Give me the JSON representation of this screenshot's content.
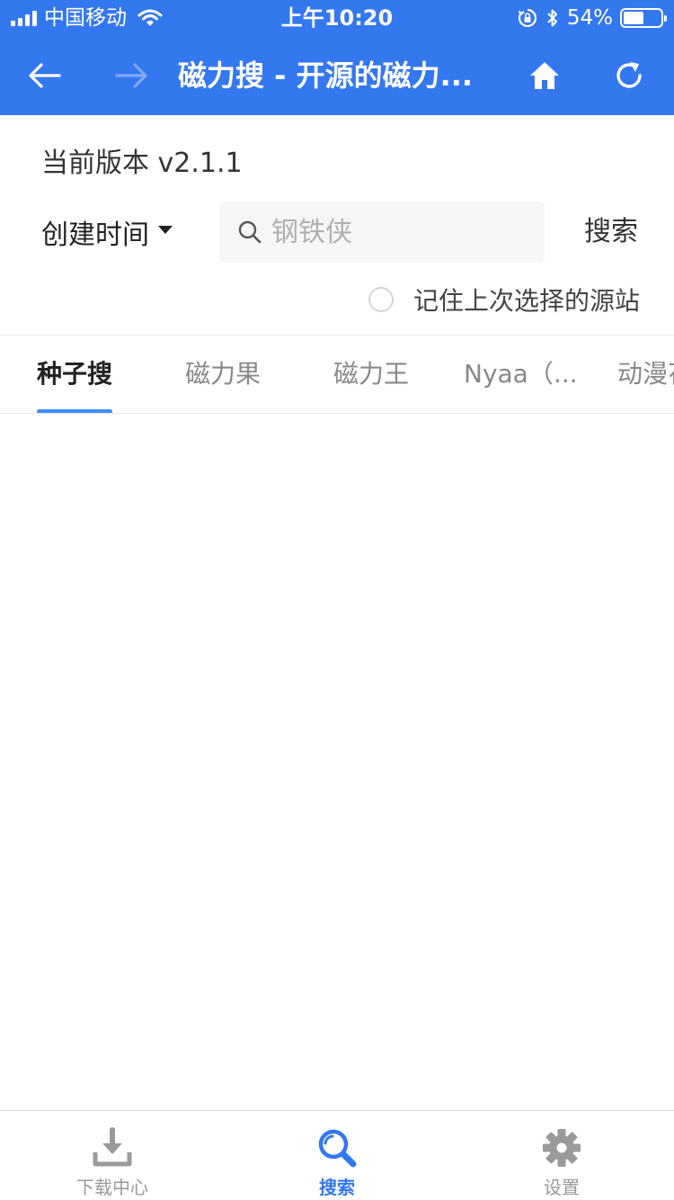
{
  "status_bar": {
    "carrier": "中国移动",
    "time": "上午10:20",
    "battery_percent_text": "54%",
    "battery_level": 0.54
  },
  "nav": {
    "title": "磁力搜 - 开源的磁力..."
  },
  "version_text": "当前版本 v2.1.1",
  "sort": {
    "selected": "创建时间"
  },
  "search": {
    "placeholder": "钢铁侠",
    "button_label": "搜索"
  },
  "remember": {
    "label": "记住上次选择的源站",
    "checked": false
  },
  "tabs": [
    {
      "label": "种子搜",
      "active": true
    },
    {
      "label": "磁力果",
      "active": false
    },
    {
      "label": "磁力王",
      "active": false
    },
    {
      "label": "Nyaa（...",
      "active": false
    },
    {
      "label": "动漫花园",
      "active": false
    }
  ],
  "tabbar": [
    {
      "label": "下载中心",
      "icon": "download-icon",
      "active": false
    },
    {
      "label": "搜索",
      "icon": "search-icon",
      "active": true
    },
    {
      "label": "设置",
      "icon": "gear-icon",
      "active": false
    }
  ],
  "colors": {
    "brand": "#3478F0",
    "tab_indicator": "#3F8CF7",
    "inactive": "#999999"
  }
}
